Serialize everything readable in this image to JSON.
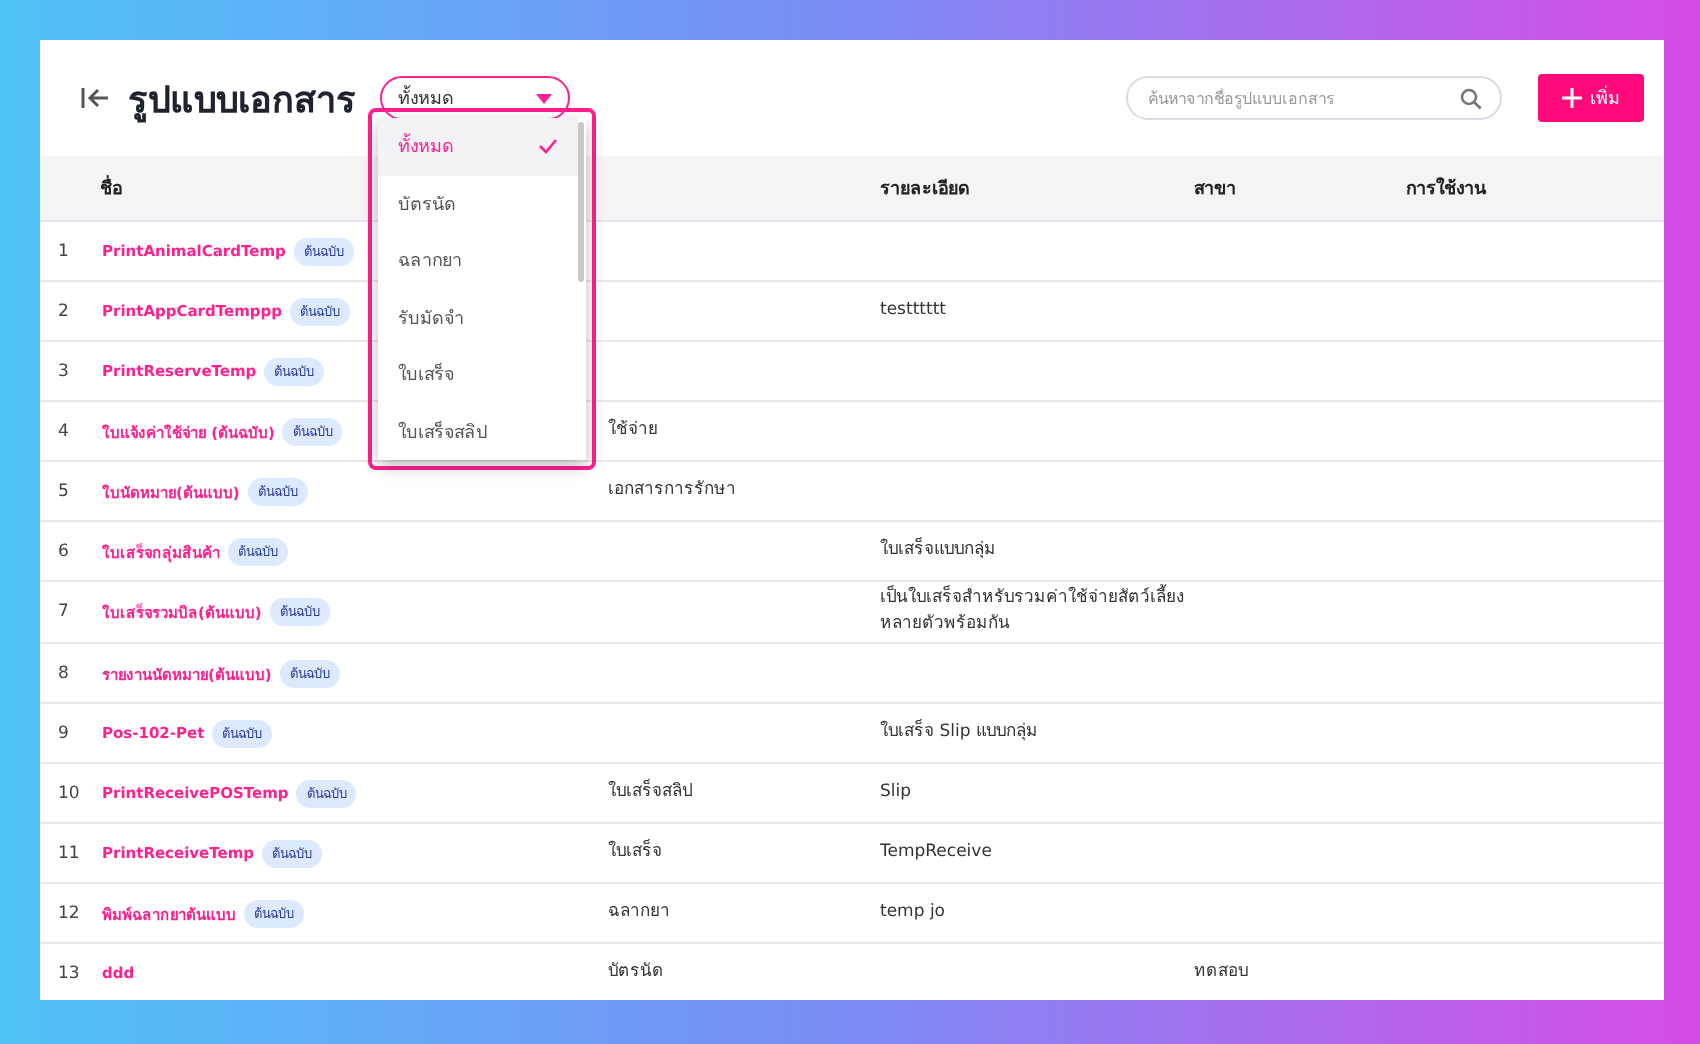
{
  "header": {
    "title": "รูปแบบเอกสาร",
    "filter": {
      "value": "ทั้งหมด",
      "expanded": true,
      "options": [
        {
          "label": "ทั้งหมด",
          "selected": true
        },
        {
          "label": "บัตรนัด",
          "selected": false
        },
        {
          "label": "ฉลากยา",
          "selected": false
        },
        {
          "label": "รับมัดจำ",
          "selected": false
        },
        {
          "label": "ใบเสร็จ",
          "selected": false
        },
        {
          "label": "ใบเสร็จสลิป",
          "selected": false
        }
      ]
    },
    "search": {
      "placeholder": "ค้นหาจากชื่อรูปแบบเอกสาร"
    },
    "add_button": "เพิ่ม"
  },
  "table": {
    "columns": [
      "",
      "ชื่อ",
      "",
      "รายละเอียด",
      "สาขา",
      "การใช้งาน"
    ],
    "rows": [
      {
        "no": "1",
        "name": "PrintAnimalCardTemp",
        "badge": "ต้นฉบับ",
        "type": "",
        "detail": "",
        "branch": ""
      },
      {
        "no": "2",
        "name": "PrintAppCardTemppp",
        "badge": "ต้นฉบับ",
        "type": "",
        "detail": "testttttt",
        "branch": ""
      },
      {
        "no": "3",
        "name": "PrintReserveTemp",
        "badge": "ต้นฉบับ",
        "type": "",
        "detail": "",
        "branch": ""
      },
      {
        "no": "4",
        "name": "ใบแจ้งค่าใช้จ่าย (ต้นฉบับ)",
        "badge": "ต้นฉบับ",
        "type": "ใช้จ่าย",
        "detail": "",
        "branch": ""
      },
      {
        "no": "5",
        "name": "ใบนัดหมาย(ต้นแบบ)",
        "badge": "ต้นฉบับ",
        "type": "เอกสารการรักษา",
        "detail": "",
        "branch": ""
      },
      {
        "no": "6",
        "name": "ใบเสร็จกลุ่มสินค้า",
        "badge": "ต้นฉบับ",
        "type": "",
        "detail": "ใบเสร็จแบบกลุ่ม",
        "branch": ""
      },
      {
        "no": "7",
        "name": "ใบเสร็จรวมบิล(ต้นแบบ)",
        "badge": "ต้นฉบับ",
        "type": "",
        "detail": "เป็นใบเสร็จสำหรับรวมค่าใช้จ่ายสัตว์เลี้ยงหลายตัวพร้อมกัน",
        "branch": ""
      },
      {
        "no": "8",
        "name": "รายงานนัดหมาย(ต้นแบบ)",
        "badge": "ต้นฉบับ",
        "type": "",
        "detail": "",
        "branch": ""
      },
      {
        "no": "9",
        "name": "Pos-102-Pet",
        "badge": "ต้นฉบับ",
        "type": "",
        "detail": "ใบเสร็จ Slip แบบกลุ่ม",
        "branch": ""
      },
      {
        "no": "10",
        "name": "PrintReceivePOSTemp",
        "badge": "ต้นฉบับ",
        "type": "ใบเสร็จสลิป",
        "detail": "Slip",
        "branch": ""
      },
      {
        "no": "11",
        "name": "PrintReceiveTemp",
        "badge": "ต้นฉบับ",
        "type": "ใบเสร็จ",
        "detail": "TempReceive",
        "branch": ""
      },
      {
        "no": "12",
        "name": "พิมพ์ฉลากยาต้นแบบ",
        "badge": "ต้นฉบับ",
        "type": "ฉลากยา",
        "detail": "temp jo",
        "branch": ""
      },
      {
        "no": "13",
        "name": "ddd",
        "badge": "",
        "type": "บัตรนัด",
        "detail": "",
        "branch": "ทดสอบ"
      }
    ]
  }
}
